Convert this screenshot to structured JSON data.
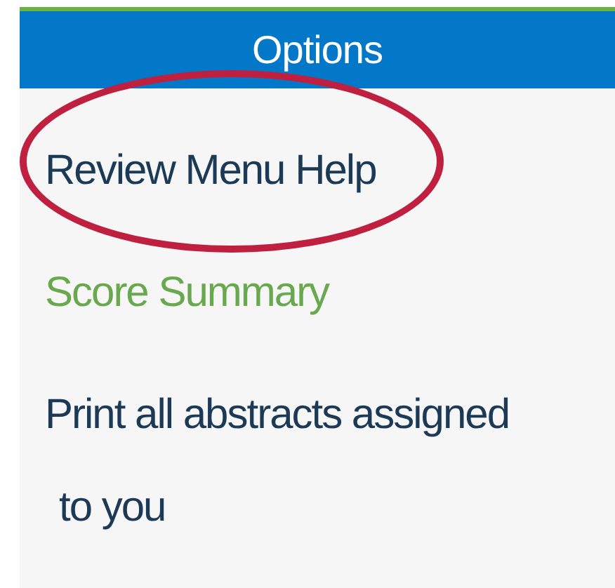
{
  "header": {
    "title": "Options"
  },
  "items": [
    {
      "label": "Review Menu Help",
      "selected": false,
      "circled": true
    },
    {
      "label": "Score Summary",
      "selected": true,
      "circled": false
    },
    {
      "label": "Print all abstracts assigned to you",
      "selected": false,
      "circled": false
    }
  ]
}
